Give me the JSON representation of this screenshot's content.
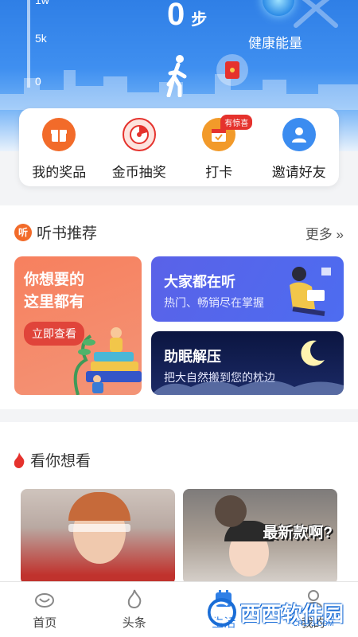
{
  "header": {
    "scale_labels": [
      "1w",
      "5k",
      "0"
    ],
    "steps_value": "0",
    "steps_unit": "步",
    "energy_label": "健康能量"
  },
  "quick_actions": [
    {
      "label": "我的奖品",
      "icon": "gift-icon",
      "color": "#f26b2a"
    },
    {
      "label": "金币抽奖",
      "icon": "lottery-wheel-icon",
      "color": "#e5322d"
    },
    {
      "label": "打卡",
      "icon": "calendar-check-icon",
      "color": "#f29a2a",
      "badge": "有惊喜"
    },
    {
      "label": "邀请好友",
      "icon": "user-icon",
      "color": "#3b8cf0"
    }
  ],
  "audio_section": {
    "title": "听书推荐",
    "icon_text": "听",
    "more": "更多 »",
    "card_main": {
      "line1": "你想要的",
      "line2": "这里都有",
      "button": "立即查看"
    },
    "card_hot": {
      "title": "大家都在听",
      "subtitle": "热门、畅销尽在掌握"
    },
    "card_sleep": {
      "title": "助眠解压",
      "subtitle": "把大自然搬到您的枕边"
    }
  },
  "video_section": {
    "title": "看你想看",
    "videos": [
      {
        "overlay": ""
      },
      {
        "overlay": "最新款啊?"
      }
    ]
  },
  "tabs": [
    {
      "label": "首页",
      "icon": "home-icon"
    },
    {
      "label": "头条",
      "icon": "flame-icon"
    },
    {
      "label": "生活",
      "icon": "calendar-icon"
    },
    {
      "label": "我的",
      "icon": "profile-icon"
    }
  ],
  "watermark": {
    "text": "西西软件园",
    "sub": "CR173.COM"
  },
  "colors": {
    "accent": "#2f7fe6",
    "orange": "#f26b2a",
    "red": "#e5322d"
  }
}
